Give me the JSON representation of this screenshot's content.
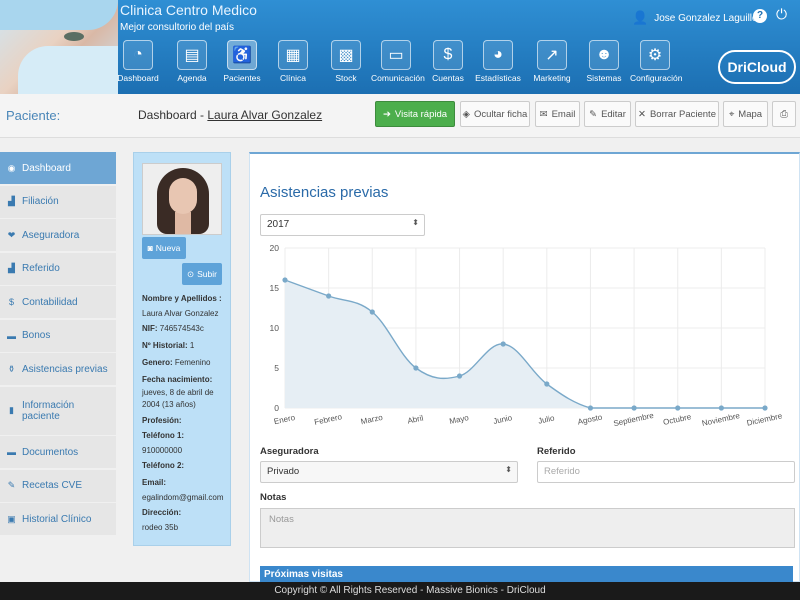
{
  "header": {
    "clinic_name": "Clinica Centro Medico",
    "clinic_subtitle": "Mejor consultorio del país",
    "user_name": "Jose Gonzalez Laguillo",
    "logo": "DriCloud",
    "modules": [
      {
        "label": "Dashboard",
        "icon": "gauge-icon",
        "glyph": "◔"
      },
      {
        "label": "Agenda",
        "icon": "notebook-icon",
        "glyph": "▤"
      },
      {
        "label": "Pacientes",
        "icon": "wheelchair-icon",
        "glyph": "♿"
      },
      {
        "label": "Clínica",
        "icon": "clipboard-icon",
        "glyph": "▦"
      },
      {
        "label": "Stock",
        "icon": "boxes-icon",
        "glyph": "▩"
      },
      {
        "label": "Comunicación",
        "icon": "chat-icon",
        "glyph": "▭"
      },
      {
        "label": "Cuentas",
        "icon": "money-icon",
        "glyph": "$"
      },
      {
        "label": "Estadísticas",
        "icon": "pie-chart-icon",
        "glyph": "◕"
      },
      {
        "label": "Marketing",
        "icon": "line-chart-icon",
        "glyph": "↗"
      },
      {
        "label": "Sistemas",
        "icon": "user-gear-icon",
        "glyph": "☻"
      },
      {
        "label": "Configuración",
        "icon": "gears-icon",
        "glyph": "⚙"
      }
    ],
    "active_module": "Pacientes"
  },
  "patient_bar": {
    "label": "Paciente:",
    "title_prefix": "Dashboard - ",
    "patient_name": "Laura Alvar Gonzalez",
    "buttons": {
      "quick_visit": "Visita rápida",
      "hide": "Ocultar ficha",
      "email": "Email",
      "edit": "Editar",
      "delete": "Borrar Paciente",
      "map": "Mapa"
    }
  },
  "sidebar": {
    "items": [
      {
        "label": "Dashboard",
        "icon": "circle-icon",
        "glyph": "◉"
      },
      {
        "label": "Filiación",
        "icon": "bar-chart-icon",
        "glyph": "▟"
      },
      {
        "label": "Aseguradora",
        "icon": "heart-hand-icon",
        "glyph": "❤"
      },
      {
        "label": "Referido",
        "icon": "bar-chart-icon",
        "glyph": "▟"
      },
      {
        "label": "Contabilidad",
        "icon": "dollar-icon",
        "glyph": "$"
      },
      {
        "label": "Bonos",
        "icon": "card-icon",
        "glyph": "▬"
      },
      {
        "label": "Asistencias previas",
        "icon": "flask-icon",
        "glyph": "⚱"
      },
      {
        "label": "Información paciente",
        "icon": "document-icon",
        "glyph": "▮"
      },
      {
        "label": "Documentos",
        "icon": "folder-icon",
        "glyph": "▬"
      },
      {
        "label": "Recetas CVE",
        "icon": "pencil-icon",
        "glyph": "✎"
      },
      {
        "label": "Historial Clínico",
        "icon": "history-icon",
        "glyph": "▣"
      }
    ]
  },
  "patient_card": {
    "new_label": "Nueva",
    "upload_label": "Subir",
    "fields": {
      "name_label": "Nombre y Apellidos",
      "name_value": "Laura Alvar Gonzalez",
      "nif_label": "NIF",
      "nif_value": "746574543c",
      "history_label": "Nº Historial",
      "history_value": "1",
      "gender_label": "Genero",
      "gender_value": "Femenino",
      "birth_label": "Fecha nacimiento",
      "birth_value": "jueves, 8 de abril de 2004 (13 años)",
      "profession_label": "Profesión",
      "phone1_label": "Teléfono 1",
      "phone1_value": "910000000",
      "phone2_label": "Teléfono 2",
      "email_label": "Email",
      "email_value": "egalindom@gmail.com",
      "address_label": "Dirección",
      "address_value": "rodeo 35b"
    }
  },
  "main": {
    "title": "Asistencias previas",
    "year_select": "2017",
    "insurer_label": "Aseguradora",
    "insurer_value": "Privado",
    "referred_label": "Referido",
    "referred_placeholder": "Referido",
    "notes_label": "Notas",
    "notes_placeholder": "Notas",
    "next_visits_label": "Próximas visitas"
  },
  "chart_data": {
    "type": "area",
    "categories": [
      "Enero",
      "Febrero",
      "Marzo",
      "Abril",
      "Mayo",
      "Junio",
      "Julio",
      "Agosto",
      "Septiembre",
      "Octubre",
      "Noviembre",
      "Diciembre"
    ],
    "values": [
      16,
      14,
      12,
      5,
      4,
      8,
      3,
      0,
      0,
      0,
      0,
      0
    ],
    "ylim": [
      0,
      20
    ],
    "yticks": [
      0,
      5,
      10,
      15,
      20
    ],
    "grid": true,
    "colors": {
      "line": "#7aa9c9",
      "fill": "#e6eef4"
    }
  },
  "footer": "Copyright © All Rights Reserved - Massive Bionics - DriCloud"
}
